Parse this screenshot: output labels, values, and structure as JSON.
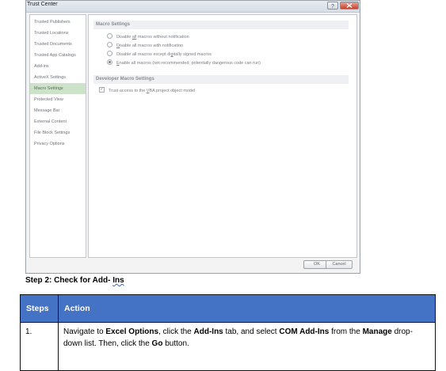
{
  "dialog": {
    "title": "Trust Center",
    "sidebar_items": [
      "Trusted Publishers",
      "Trusted Locations",
      "Trusted Documents",
      "Trusted App Catalogs",
      "Add-ins",
      "ActiveX Settings",
      "Macro Settings",
      "Protected View",
      "Message Bar",
      "External Content",
      "File Block Settings",
      "Privacy Options"
    ],
    "active_item": "Macro Settings",
    "macro_section_title": "Macro Settings",
    "macro_options": {
      "opt1_pre": "Disable ",
      "opt1_key": "all",
      "opt1_post": " macros without notification",
      "opt2_pre": "",
      "opt2_key": "D",
      "opt2_post": "isable all macros with notification",
      "opt3_pre": "Disable all macros except di",
      "opt3_key": "g",
      "opt3_post": "itally signed macros",
      "opt4_pre": "",
      "opt4_key": "E",
      "opt4_post": "nable all macros (not recommended; potentially dangerous code can run)"
    },
    "selected_option": 4,
    "developer_section_title": "Developer Macro Settings",
    "vba_pre": "Trust access to the ",
    "vba_key": "V",
    "vba_post": "BA project object model",
    "vba_checked": true,
    "ok_label": "OK",
    "cancel_label": "Cancel"
  },
  "step_heading": {
    "prefix": "Step 2: Check for Add- ",
    "suffix": "Ins"
  },
  "table": {
    "headers": [
      "Steps",
      "Action"
    ],
    "row": {
      "step": "1.",
      "t1": "Navigate to ",
      "b1": "Excel Options",
      "t2": ", click the ",
      "b2": "Add-Ins",
      "t3": " tab, and select ",
      "b3": "COM Add-Ins",
      "t4": " from the ",
      "b4": "Manage",
      "t5": " drop-down list. Then, click the ",
      "b5": "Go",
      "t6": " button."
    }
  }
}
